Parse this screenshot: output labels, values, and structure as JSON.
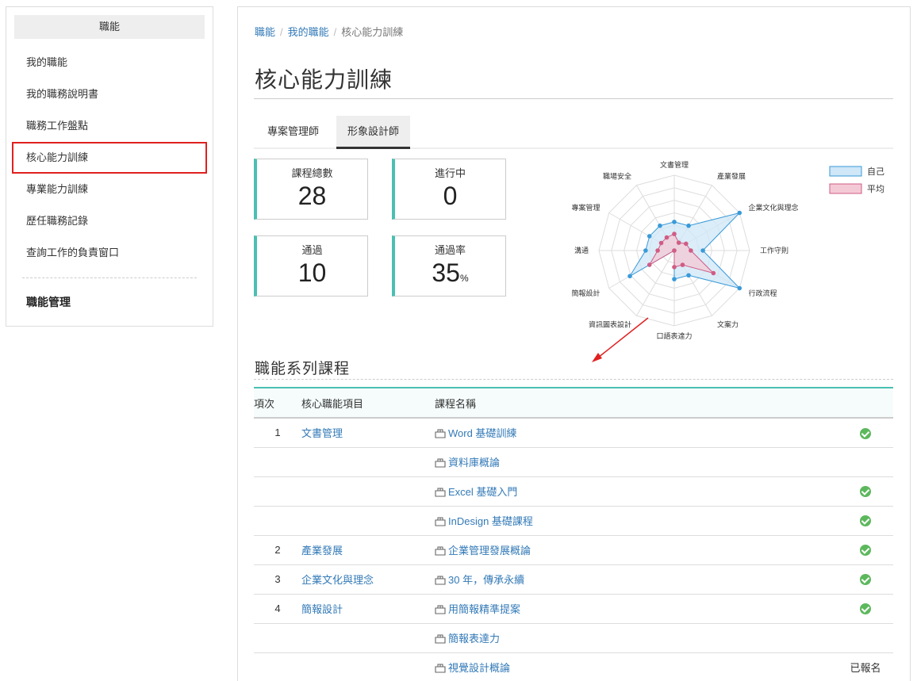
{
  "sidebar": {
    "header": "職能",
    "items": [
      "我的職能",
      "我的職務說明書",
      "職務工作盤點",
      "核心能力訓練",
      "專業能力訓練",
      "歷任職務記錄",
      "查詢工作的負責窗口"
    ],
    "active_index": 3,
    "sub_header": "職能管理"
  },
  "breadcrumb": [
    "職能",
    "我的職能",
    "核心能力訓練"
  ],
  "page_title": "核心能力訓練",
  "tabs": [
    "專案管理師",
    "形象設計師"
  ],
  "active_tab": 1,
  "stats": {
    "total": {
      "label": "課程總數",
      "value": "28"
    },
    "in_progress": {
      "label": "進行中",
      "value": "0"
    },
    "passed": {
      "label": "通過",
      "value": "10"
    },
    "pass_rate": {
      "label": "通過率",
      "value": "35",
      "unit": "%"
    }
  },
  "chart_data": {
    "type": "radar",
    "axes": [
      "文書管理",
      "產業發展",
      "企業文化與理念",
      "工作守則",
      "行政流程",
      "文案力",
      "口語表達力",
      "資訊圖表設計",
      "簡報設計",
      "溝通",
      "專案管理",
      "職場安全"
    ],
    "series": [
      {
        "name": "自己",
        "values": [
          0.38,
          0.38,
          1.0,
          0.38,
          1.0,
          0.38,
          0.38,
          0.0,
          0.68,
          0.38,
          0.38,
          0.38
        ],
        "color": "#3a9ad9",
        "fill": "#cfe7f7"
      },
      {
        "name": "平均",
        "values": [
          0.22,
          0.12,
          0.18,
          0.22,
          0.6,
          0.22,
          0.22,
          0.0,
          0.38,
          0.22,
          0.2,
          0.2
        ],
        "color": "#d05c85",
        "fill": "#f4c9d6"
      }
    ],
    "max": 1,
    "rings": 6,
    "legend": "top-right"
  },
  "section_title": "職能系列課程",
  "table": {
    "headers": [
      "項次",
      "核心職能項目",
      "課程名稱",
      ""
    ],
    "rows": [
      {
        "no": "1",
        "item": "文書管理",
        "course": "Word 基礎訓練",
        "status": "done"
      },
      {
        "no": "",
        "item": "",
        "course": "資料庫概論",
        "status": ""
      },
      {
        "no": "",
        "item": "",
        "course": "Excel 基礎入門",
        "status": "done"
      },
      {
        "no": "",
        "item": "",
        "course": "InDesign 基礎課程",
        "status": "done"
      },
      {
        "no": "2",
        "item": "產業發展",
        "course": "企業管理發展概論",
        "status": "done"
      },
      {
        "no": "3",
        "item": "企業文化與理念",
        "course": "30 年，傳承永續",
        "status": "done"
      },
      {
        "no": "4",
        "item": "簡報設計",
        "course": "用簡報精準提案",
        "status": "done"
      },
      {
        "no": "",
        "item": "",
        "course": "簡報表達力",
        "status": ""
      },
      {
        "no": "",
        "item": "",
        "course": "視覺設計概論",
        "status": "已報名"
      }
    ]
  },
  "icons": {
    "course": "course-box-icon",
    "done": "check-circle-icon"
  }
}
